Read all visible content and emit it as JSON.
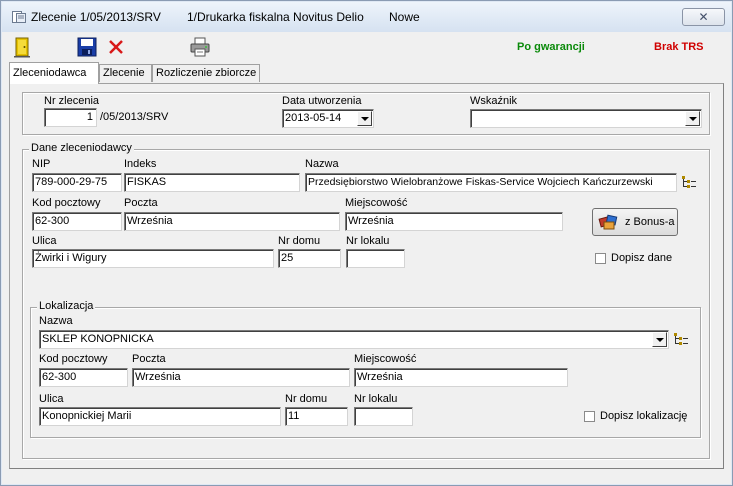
{
  "window": {
    "title_doc": "Zlecenie 1/05/2013/SRV",
    "title_device": "1/Drukarka fiskalna Novitus Delio",
    "title_status": "Nowe",
    "close_label": "✕"
  },
  "toolbar": {
    "warranty_status": "Po gwarancji",
    "trs_status": "Brak TRS"
  },
  "tabs": [
    {
      "label": "Zleceniodawca"
    },
    {
      "label": "Zlecenie"
    },
    {
      "label": "Rozliczenie zbiorcze"
    }
  ],
  "order": {
    "number_label": "Nr zlecenia",
    "number_value": "1",
    "number_suffix": "/05/2013/SRV",
    "created_label": "Data utworzenia",
    "created_value": "2013-05-14",
    "indicator_label": "Wskaźnik",
    "indicator_value": ""
  },
  "customer": {
    "legend": "Dane zleceniodawcy",
    "nip_label": "NIP",
    "nip_value": "789-000-29-75",
    "index_label": "Indeks",
    "index_value": "FISKAS",
    "name_label": "Nazwa",
    "name_value": "Przedsiębiorstwo Wielobranżowe Fiskas-Service Wojciech Kańczurzewski",
    "zip_label": "Kod pocztowy",
    "zip_value": "62-300",
    "post_label": "Poczta",
    "post_value": "Września",
    "city_label": "Miejscowość",
    "city_value": "Września",
    "bonus_button": "z Bonus-a",
    "street_label": "Ulica",
    "street_value": "Żwirki i Wigury",
    "house_label": "Nr domu",
    "house_value": "25",
    "flat_label": "Nr lokalu",
    "flat_value": "",
    "add_data_label": "Dopisz dane"
  },
  "location": {
    "legend": "Lokalizacja",
    "name_label": "Nazwa",
    "name_value": "SKLEP KONOPNICKA",
    "zip_label": "Kod pocztowy",
    "zip_value": "62-300",
    "post_label": "Poczta",
    "post_value": "Września",
    "city_label": "Miejscowość",
    "city_value": "Września",
    "street_label": "Ulica",
    "street_value": "Konopnickiej Marii",
    "house_label": "Nr domu",
    "house_value": "11",
    "flat_label": "Nr lokalu",
    "flat_value": "",
    "add_location_label": "Dopisz lokalizację"
  },
  "icons": [
    "window-doc-icon",
    "exit-door-icon",
    "save-disk-icon",
    "delete-x-icon",
    "printer-icon",
    "bonus-import-icon",
    "tree-browse-icon"
  ],
  "colors": {
    "warranty": "#0a8a0a",
    "trs": "#d00000"
  }
}
